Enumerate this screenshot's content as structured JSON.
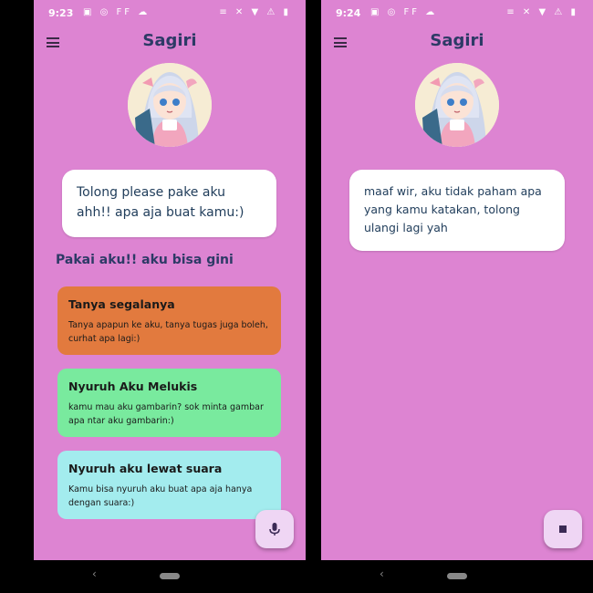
{
  "screens": [
    {
      "status": {
        "time": "9:23",
        "left_icons": "▣ ◎ FF ☁",
        "right_icons": "≡ ✕ ▼ ⚠ ▮"
      },
      "appbar": {
        "title": "Sagiri",
        "menu_icon": "menu-icon"
      },
      "message": "Tolong please pake aku ahh!! apa aja buat kamu:)",
      "section_title": "Pakai aku!! aku bisa gini",
      "cards": [
        {
          "title": "Tanya segalanya",
          "desc": "Tanya apapun ke aku, tanya tugas juga boleh, curhat apa lagi:)",
          "color": "#e27a3e"
        },
        {
          "title": "Nyuruh Aku Melukis",
          "desc": "kamu mau aku gambarin? sok minta gambar apa ntar aku gambarin:)",
          "color": "#79ea9e"
        },
        {
          "title": "Nyuruh aku lewat suara",
          "desc": "Kamu bisa nyuruh aku buat apa aja hanya dengan suara:)",
          "color": "#a3ecee"
        }
      ],
      "fab_icon": "microphone-icon"
    },
    {
      "status": {
        "time": "9:24",
        "left_icons": "▣ ◎ FF ☁",
        "right_icons": "≡ ✕ ▼ ⚠ ▮"
      },
      "appbar": {
        "title": "Sagiri",
        "menu_icon": "menu-icon"
      },
      "message": "maaf wir, aku tidak paham apa yang kamu katakan, tolong ulangi lagi yah",
      "fab_icon": "stop-icon"
    }
  ],
  "navbar": {
    "back_glyph": "‹"
  },
  "colors": {
    "background": "#dd84d2",
    "title": "#2d3a66",
    "fab": "#efd6f4"
  }
}
